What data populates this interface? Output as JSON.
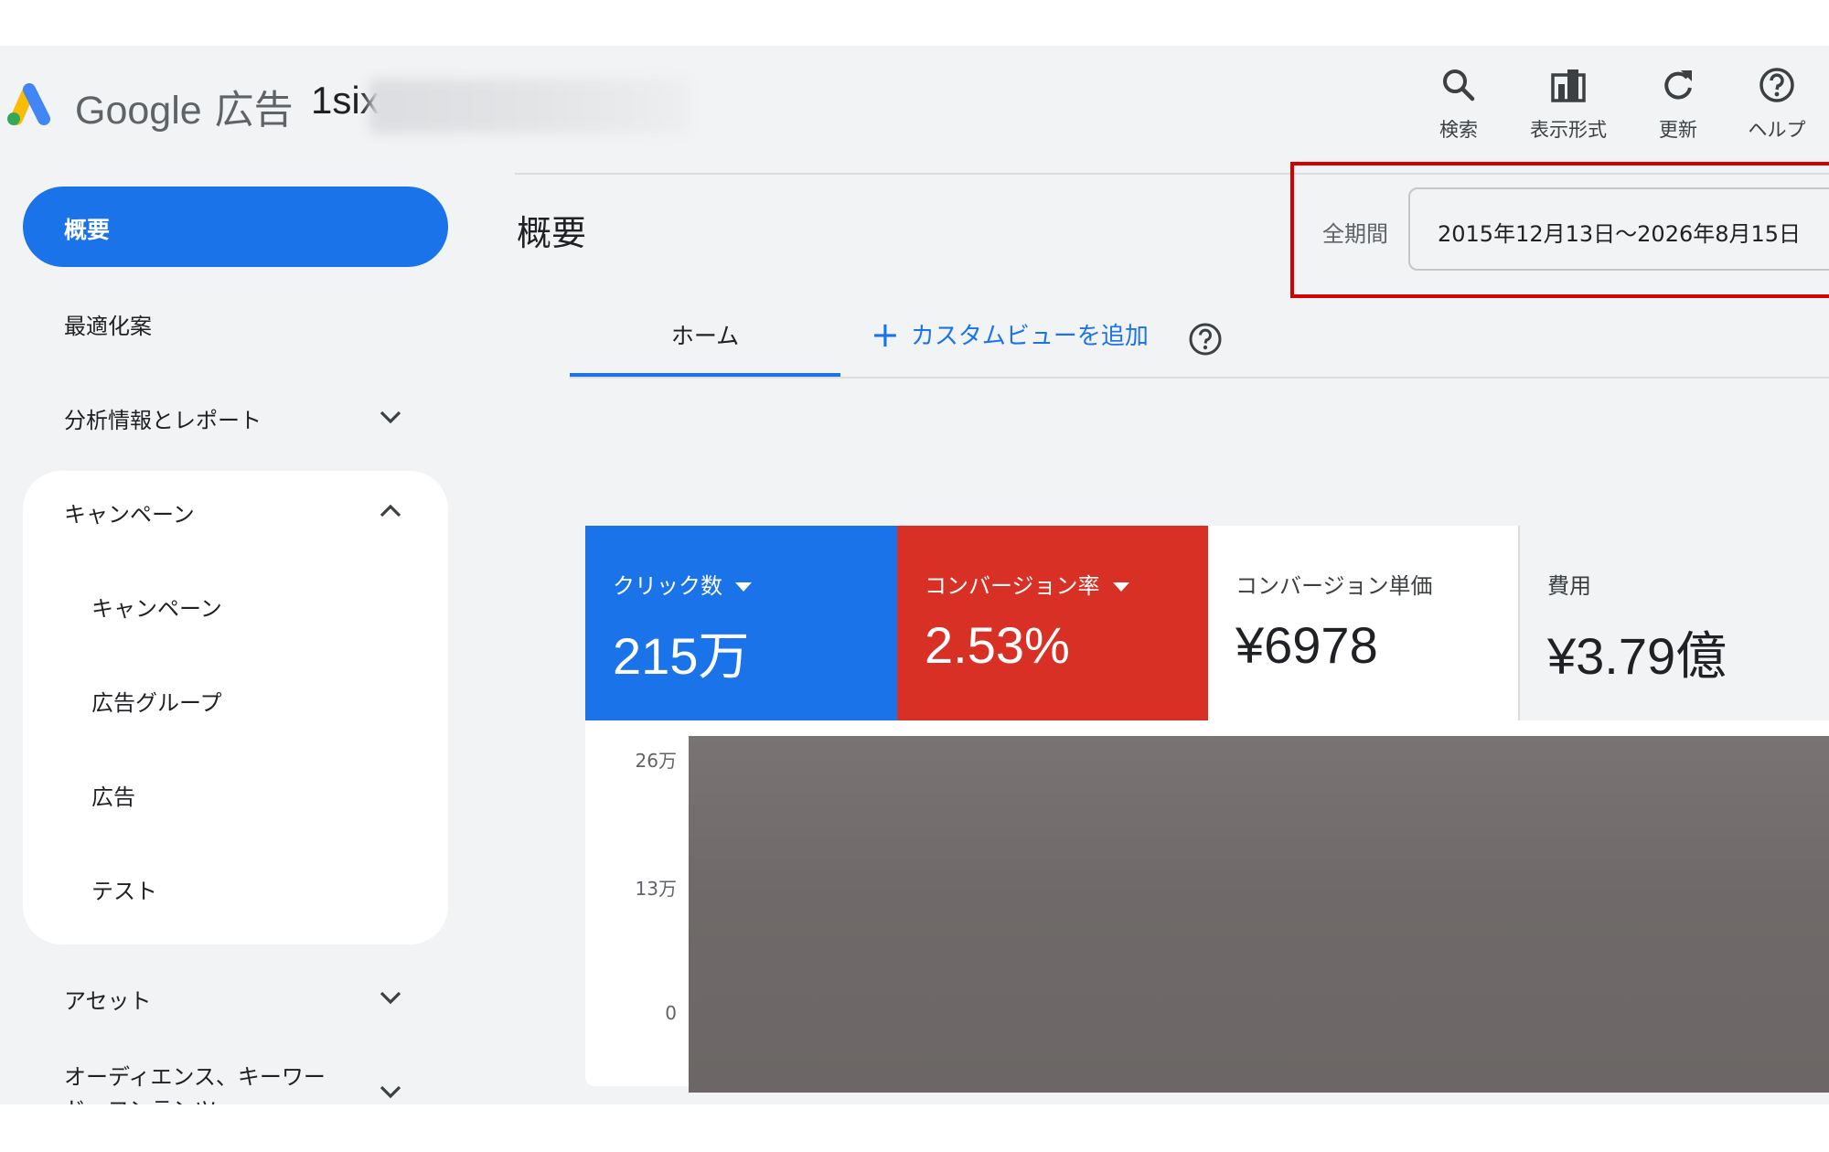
{
  "header": {
    "brand": "Google",
    "product": "広告",
    "account": "1six",
    "tools": [
      {
        "icon": "search-icon",
        "label": "検索"
      },
      {
        "icon": "view-format-icon",
        "label": "表示形式"
      },
      {
        "icon": "refresh-icon",
        "label": "更新"
      },
      {
        "icon": "help-icon",
        "label": "ヘルプ"
      }
    ]
  },
  "sidebar": {
    "items": [
      {
        "label": "概要",
        "active": true
      },
      {
        "label": "最適化案"
      },
      {
        "label": "分析情報とレポート",
        "expandable": true
      },
      {
        "label": "キャンペーン",
        "expanded": true
      },
      {
        "label": "キャンペーン"
      },
      {
        "label": "広告グループ"
      },
      {
        "label": "広告"
      },
      {
        "label": "テスト"
      },
      {
        "label": "アセット",
        "expandable": true
      },
      {
        "label": "オーディエンス、キーワード、コンテンツ",
        "expandable": true
      }
    ]
  },
  "main": {
    "title": "概要",
    "date_label": "全期間",
    "date_range": "2015年12月13日～2026年8月15日",
    "tabs": [
      {
        "label": "ホーム",
        "active": true
      },
      {
        "label": "カスタムビューを追加"
      }
    ],
    "metrics": [
      {
        "title": "クリック数",
        "value": "215万",
        "color": "#1a73e8"
      },
      {
        "title": "コンバージョン率",
        "value": "2.53%",
        "color": "#d93025"
      },
      {
        "title": "コンバージョン単価",
        "value": "¥6978"
      },
      {
        "title": "費用",
        "value": "¥3.79億"
      }
    ],
    "chart_yticks": [
      "26万",
      "13万",
      "0"
    ]
  },
  "colors": {
    "accent": "#1a73e8",
    "alert": "#d93025",
    "highlight": "#d50000"
  }
}
